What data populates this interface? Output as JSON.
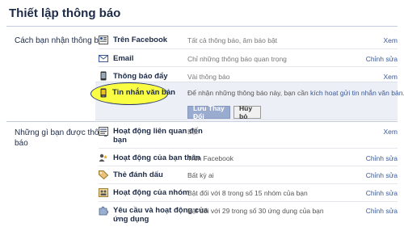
{
  "page_title": "Thiết lập thông báo",
  "section1": {
    "label": "Cách bạn nhận thông báo",
    "rows": [
      {
        "name": "Trên Facebook",
        "value": "Tất cả thông báo, âm báo bật",
        "action": "Xem",
        "icon": "facebook-globe-icon"
      },
      {
        "name": "Email",
        "value": "Chỉ những thông báo quan trọng",
        "action": "Chỉnh sửa",
        "icon": "envelope-icon"
      },
      {
        "name": "Thông báo đẩy",
        "value": "Vài thông báo",
        "action": "Xem",
        "icon": "mobile-phone-icon"
      }
    ],
    "sms": {
      "name": "Tin nhắn văn bản",
      "icon": "sms-phone-icon",
      "desc_prefix": "Để nhận những thông báo này, bạn cần ",
      "desc_link": "kích hoạt gửi tin nhắn văn bản",
      "desc_suffix": ".",
      "save_label": "Lưu Thay Đổi",
      "cancel_label": "Hủy bỏ"
    }
  },
  "section2": {
    "label_line1": "Những gì bạn được thông",
    "label_line2": "báo",
    "rows": [
      {
        "name_line1": "Hoạt động liên quan đến",
        "name_line2": "bạn",
        "value": "Bật",
        "action": "Xem",
        "icon": "notification-list-icon"
      },
      {
        "name_line1": "Hoạt động của bạn thân",
        "name_line2": "",
        "value": "Trên Facebook",
        "action": "Chỉnh sửa",
        "icon": "close-friends-icon"
      },
      {
        "name_line1": "Thẻ đánh dấu",
        "name_line2": "",
        "value": "Bất kỳ ai",
        "action": "Chỉnh sửa",
        "icon": "tag-icon"
      },
      {
        "name_line1": "Hoạt động của nhóm",
        "name_line2": "",
        "value": "Bật đối với 8 trong số 15 nhóm của bạn",
        "action": "Chỉnh sửa",
        "icon": "groups-icon"
      },
      {
        "name_line1": "Yêu cầu và hoạt động của",
        "name_line2": "ứng dụng",
        "value": "Bật đối với 29 trong số 30 ứng dụng của bạn",
        "action": "Chỉnh sửa",
        "icon": "app-puzzle-icon"
      }
    ]
  },
  "colors": {
    "title": "#1c2a47",
    "link": "#3b5998",
    "panel": "#eceff5",
    "highlight": "#fbff39"
  }
}
